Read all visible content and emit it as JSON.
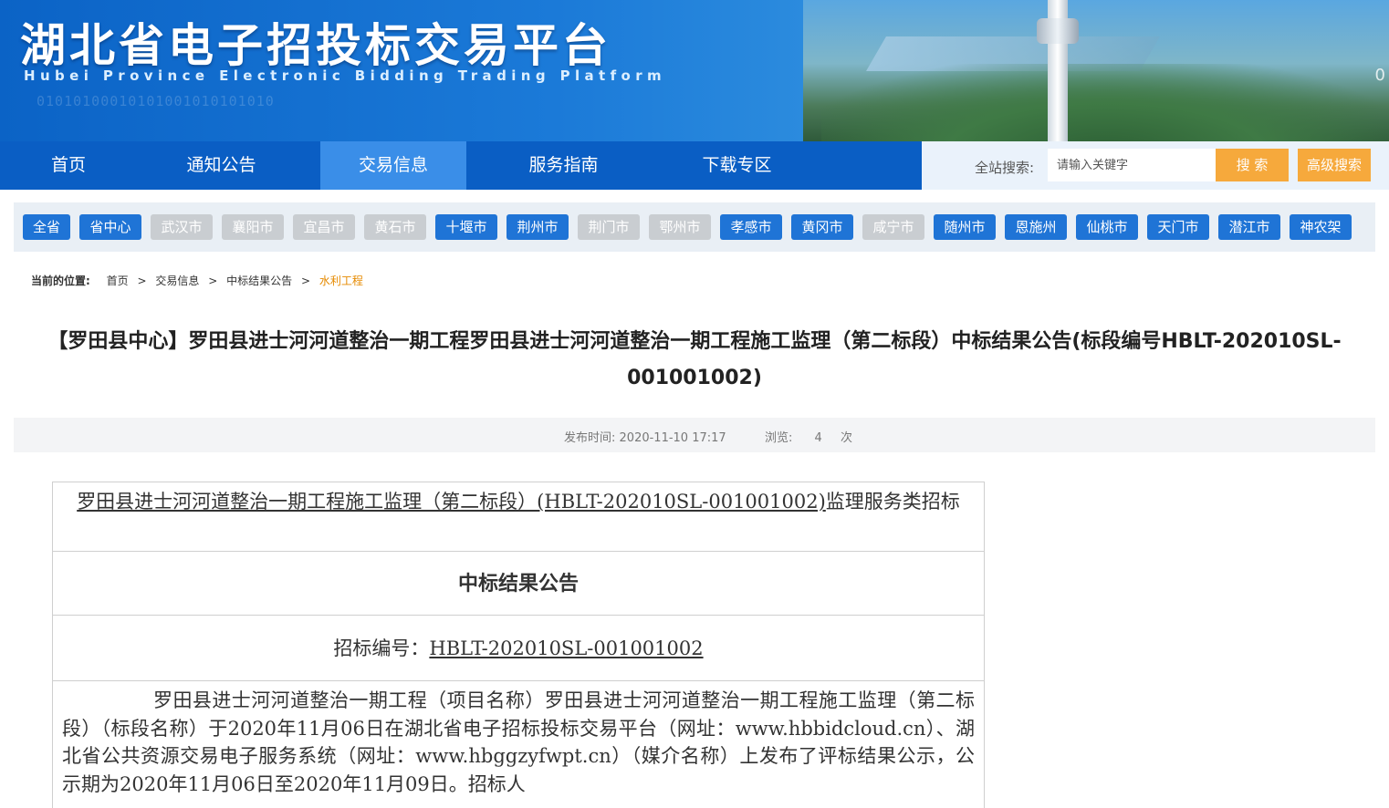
{
  "banner": {
    "title_cn": "湖北省电子招投标交易平台",
    "title_en": "Hubei Province Electronic Bidding Trading Platform",
    "binary_text": "01010100010101001010101010",
    "corner_digit": "0"
  },
  "nav": {
    "items": [
      "首页",
      "通知公告",
      "交易信息",
      "服务指南",
      "下载专区"
    ],
    "active": "交易信息",
    "search_label": "全站搜索:",
    "search_placeholder": "请输入关键字",
    "search_button": "搜 索",
    "advanced_button": "高级搜索"
  },
  "regions": {
    "items": [
      {
        "label": "全省",
        "enabled": true
      },
      {
        "label": "省中心",
        "enabled": true
      },
      {
        "label": "武汉市",
        "enabled": false
      },
      {
        "label": "襄阳市",
        "enabled": false
      },
      {
        "label": "宜昌市",
        "enabled": false
      },
      {
        "label": "黄石市",
        "enabled": false
      },
      {
        "label": "十堰市",
        "enabled": true
      },
      {
        "label": "荆州市",
        "enabled": true
      },
      {
        "label": "荆门市",
        "enabled": false
      },
      {
        "label": "鄂州市",
        "enabled": false
      },
      {
        "label": "孝感市",
        "enabled": true
      },
      {
        "label": "黄冈市",
        "enabled": true
      },
      {
        "label": "咸宁市",
        "enabled": false
      },
      {
        "label": "随州市",
        "enabled": true
      },
      {
        "label": "恩施州",
        "enabled": true
      },
      {
        "label": "仙桃市",
        "enabled": true
      },
      {
        "label": "天门市",
        "enabled": true
      },
      {
        "label": "潜江市",
        "enabled": true
      },
      {
        "label": "神农架",
        "enabled": true
      }
    ],
    "colors": {
      "on": "#1f74d6",
      "off": "#c9cdd1"
    }
  },
  "breadcrumb": {
    "label": "当前的位置:",
    "items": [
      "首页",
      "交易信息",
      "中标结果公告",
      "水利工程"
    ]
  },
  "article": {
    "title": "【罗田县中心】罗田县进士河河道整治一期工程罗田县进士河河道整治一期工程施工监理（第二标段）中标结果公告(标段编号HBLT-202010SL-001001002)",
    "publish_label": "发布时间:",
    "publish_time": "2020-11-10 17:17",
    "views_label": "浏览:",
    "views_count": "4",
    "views_unit": "次"
  },
  "doc": {
    "header_underlined": "罗田县进士河河道整治一期工程施工监理（第二标段）(HBLT-202010SL-001001002)",
    "header_tail": "监理服务类招标",
    "notice_title": "中标结果公告",
    "bid_no_label": "招标编号：",
    "bid_no": "HBLT-202010SL-001001002",
    "body": "罗田县进士河河道整治一期工程（项目名称）罗田县进士河河道整治一期工程施工监理（第二标段）（标段名称）于2020年11月06日在湖北省电子招标投标交易平台（网址：www.hbbidcloud.cn）、湖北省公共资源交易电子服务系统（网址：www.hbggzyfwpt.cn）（媒介名称）上发布了评标结果公示，公示期为2020年11月06日至2020年11月09日。招标人"
  }
}
